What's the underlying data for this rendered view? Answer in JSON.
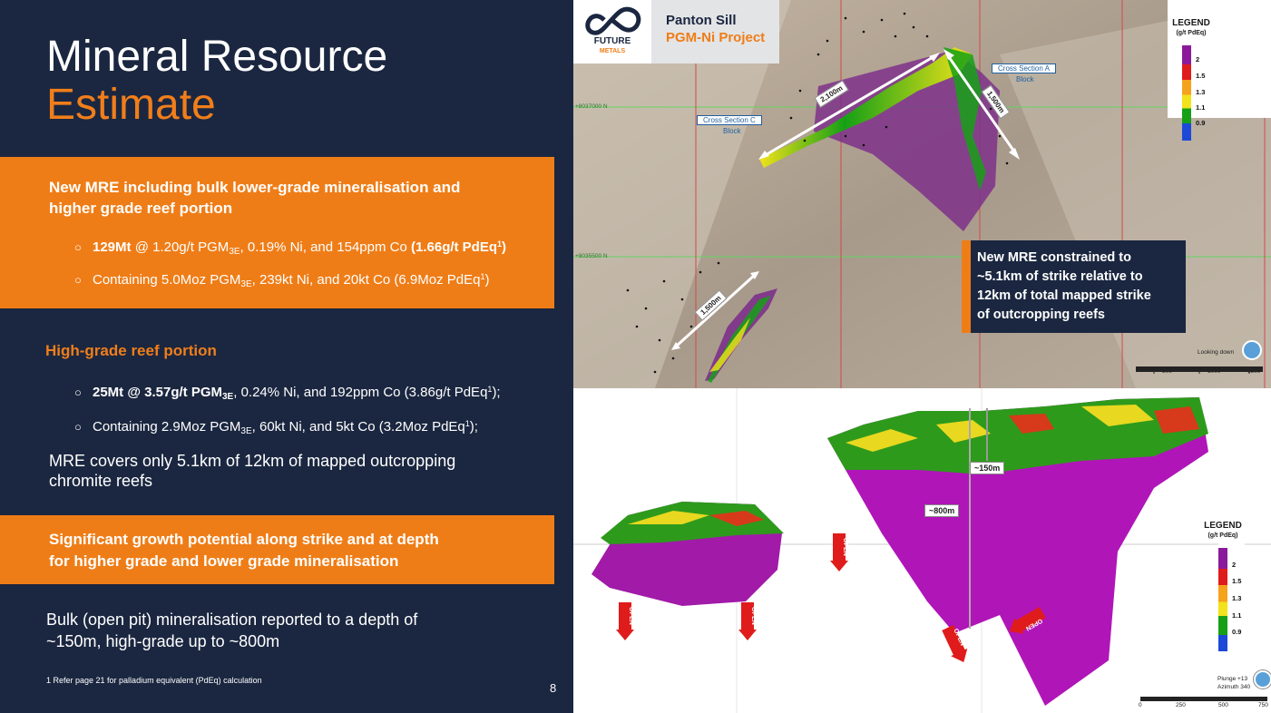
{
  "title": {
    "line1": "Mineral Resource",
    "line2": "Estimate"
  },
  "box1": {
    "heading_line1": "New MRE including bulk lower-grade mineralisation and",
    "heading_line2": "higher grade reef portion",
    "b1_bold": "129Mt",
    "b1_a": " @ 1.20g/t PGM",
    "b1_sub": "3E",
    "b1_b": ", 0.19% Ni, and 154ppm Co ",
    "b1_bold2": "(1.66g/t PdEq",
    "b1_sup": "1",
    "b1_bold3": ")",
    "b2_a": "Containing 5.0Moz PGM",
    "b2_sub": "3E",
    "b2_b": ", 239kt Ni, and 20kt Co (6.9Moz PdEq",
    "b2_sup": "1",
    "b2_c": ")"
  },
  "section2": {
    "heading": "High-grade reef portion",
    "b1_bold": "25Mt @ 3.57g/t PGM",
    "b1_sub": "3E",
    "b1_a": ", 0.24% Ni, and 192ppm Co (3.86g/t PdEq",
    "b1_sup": "1",
    "b1_b": ");",
    "b2_a": "Containing 2.9Moz PGM",
    "b2_sub": "3E",
    "b2_b": ", 60kt Ni, and 5kt Co (3.2Moz PdEq",
    "b2_sup": "1",
    "b2_c": ");",
    "para_line1": "MRE covers only 5.1km of 12km of mapped outcropping",
    "para_line2": "chromite reefs"
  },
  "box2": {
    "line1": "Significant growth potential along strike and at depth",
    "line2": "for higher grade and lower grade mineralisation"
  },
  "bottom": {
    "line1": "Bulk (open pit) mineralisation reported to a depth of",
    "line2": "~150m, high-grade up to ~800m"
  },
  "footnote": "1 Refer page 21 for palladium equivalent (PdEq) calculation",
  "page_number": "8",
  "project": {
    "line1": "Panton Sill",
    "line2": "PGM-Ni Project"
  },
  "logo": {
    "line1": "FUTURE",
    "line2": "METALS"
  },
  "callout": {
    "line1": "New MRE constrained to",
    "line2": "~5.1km of strike relative to",
    "line3": "12km of total mapped strike",
    "line4": "of outcropping reefs"
  },
  "map": {
    "xs_a": "Cross Section A",
    "xs_a_sub": "Block",
    "xs_c": "Cross Section C",
    "xs_c_sub": "Block",
    "dist1": "2,100m",
    "dist2": "1,500m",
    "dist3": "1,500m",
    "north1": "+8037000 N",
    "north2": "+8035500 N",
    "looking": "Looking down",
    "scale": [
      "500",
      "1000",
      "1500"
    ]
  },
  "legend": {
    "title1": "LEGEND",
    "title2": "(g/t PdEq)",
    "values": [
      "2",
      "1.5",
      "1.3",
      "1.1",
      "0.9"
    ],
    "colors": [
      "#8b1a9a",
      "#e01b1b",
      "#f5a21d",
      "#f2e31a",
      "#16a016",
      "#1c49d8"
    ]
  },
  "section3d": {
    "depth1": "~150m",
    "depth2": "~800m",
    "open": "OPEN",
    "plunge": "Plunge +13",
    "azimuth": "Azimuth 340",
    "scale": [
      "0",
      "250",
      "500",
      "750"
    ]
  }
}
